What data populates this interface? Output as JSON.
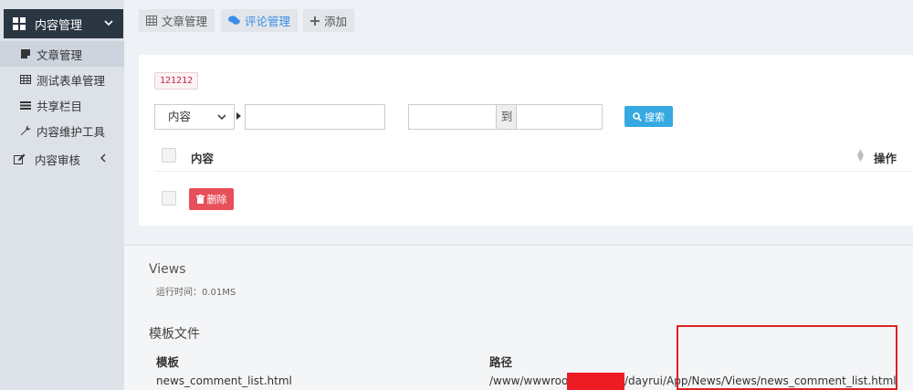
{
  "sidebar": {
    "header": {
      "label": "内容管理",
      "icon": "grid-icon"
    },
    "items": [
      {
        "label": "文章管理",
        "icon": "note-icon"
      },
      {
        "label": "测试表单管理",
        "icon": "table-icon"
      },
      {
        "label": "共享栏目",
        "icon": "list-icon"
      },
      {
        "label": "内容维护工具",
        "icon": "wrench-icon"
      }
    ],
    "group": {
      "label": "内容审核",
      "icon": "edit-icon"
    }
  },
  "tabs": [
    {
      "label": "文章管理",
      "icon": "table-icon"
    },
    {
      "label": "评论管理",
      "icon": "comments-icon"
    },
    {
      "label": "添加",
      "icon": "plus-icon"
    }
  ],
  "filter": {
    "badge": "121212",
    "select_value": "内容",
    "range_separator": "到",
    "search_label": "搜索"
  },
  "table": {
    "col_content": "内容",
    "col_action": "操作",
    "delete_label": "删除"
  },
  "debug": {
    "views_title": "Views",
    "runtime": "运行时间：0.01MS",
    "template_title": "模板文件",
    "col_template": "模板",
    "col_path": "路径",
    "template_file": "news_comment_list.html",
    "path_prefix": "/www/wwwroot/",
    "path_suffix": "/dayrui/App/News/Views/news_comment_list.html"
  },
  "colors": {
    "sidebar_header": "#2b3643",
    "search_button": "#36a9e1",
    "delete_button": "#e7505a",
    "active_tab": "#3a8ee6",
    "redaction": "#ed1c24",
    "highlight_box": "#dd2222"
  }
}
